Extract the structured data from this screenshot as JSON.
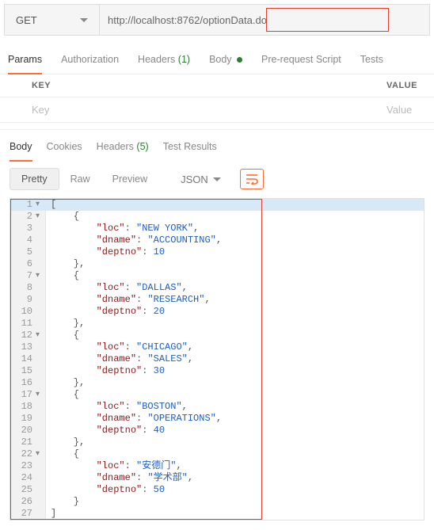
{
  "request": {
    "method": "GET",
    "url": "http://localhost:8762/optionData.do"
  },
  "requestTabs": {
    "params": "Params",
    "auth": "Authorization",
    "headers": "Headers",
    "headersCount": "(1)",
    "body": "Body",
    "prerequest": "Pre-request Script",
    "tests": "Tests"
  },
  "kv": {
    "keyHeader": "KEY",
    "valueHeader": "VALUE",
    "keyPlaceholder": "Key",
    "valuePlaceholder": "Value"
  },
  "responseTabs": {
    "body": "Body",
    "cookies": "Cookies",
    "headers": "Headers",
    "headersCount": "(5)",
    "testResults": "Test Results"
  },
  "viewer": {
    "pretty": "Pretty",
    "raw": "Raw",
    "preview": "Preview",
    "format": "JSON"
  },
  "chart_data": {
    "type": "table",
    "title": "optionData.do JSON response",
    "columns": [
      "loc",
      "dname",
      "deptno"
    ],
    "rows": [
      {
        "loc": "NEW YORK",
        "dname": "ACCOUNTING",
        "deptno": 10
      },
      {
        "loc": "DALLAS",
        "dname": "RESEARCH",
        "deptno": 20
      },
      {
        "loc": "CHICAGO",
        "dname": "SALES",
        "deptno": 30
      },
      {
        "loc": "BOSTON",
        "dname": "OPERATIONS",
        "deptno": 40
      },
      {
        "loc": "安德门",
        "dname": "学术部",
        "deptno": 50
      }
    ]
  },
  "codeLines": [
    {
      "n": 1,
      "fold": "▾",
      "tokens": [
        [
          "punc",
          "["
        ]
      ]
    },
    {
      "n": 2,
      "fold": "▾",
      "tokens": [
        [
          "punc",
          "    {"
        ]
      ]
    },
    {
      "n": 3,
      "fold": "",
      "tokens": [
        [
          "punc",
          "        "
        ],
        [
          "key",
          "\"loc\""
        ],
        [
          "punc",
          ": "
        ],
        [
          "str",
          "\"NEW YORK\""
        ],
        [
          "punc",
          ","
        ]
      ]
    },
    {
      "n": 4,
      "fold": "",
      "tokens": [
        [
          "punc",
          "        "
        ],
        [
          "key",
          "\"dname\""
        ],
        [
          "punc",
          ": "
        ],
        [
          "str",
          "\"ACCOUNTING\""
        ],
        [
          "punc",
          ","
        ]
      ]
    },
    {
      "n": 5,
      "fold": "",
      "tokens": [
        [
          "punc",
          "        "
        ],
        [
          "key",
          "\"deptno\""
        ],
        [
          "punc",
          ": "
        ],
        [
          "num",
          "10"
        ]
      ]
    },
    {
      "n": 6,
      "fold": "",
      "tokens": [
        [
          "punc",
          "    },"
        ]
      ]
    },
    {
      "n": 7,
      "fold": "▾",
      "tokens": [
        [
          "punc",
          "    {"
        ]
      ]
    },
    {
      "n": 8,
      "fold": "",
      "tokens": [
        [
          "punc",
          "        "
        ],
        [
          "key",
          "\"loc\""
        ],
        [
          "punc",
          ": "
        ],
        [
          "str",
          "\"DALLAS\""
        ],
        [
          "punc",
          ","
        ]
      ]
    },
    {
      "n": 9,
      "fold": "",
      "tokens": [
        [
          "punc",
          "        "
        ],
        [
          "key",
          "\"dname\""
        ],
        [
          "punc",
          ": "
        ],
        [
          "str",
          "\"RESEARCH\""
        ],
        [
          "punc",
          ","
        ]
      ]
    },
    {
      "n": 10,
      "fold": "",
      "tokens": [
        [
          "punc",
          "        "
        ],
        [
          "key",
          "\"deptno\""
        ],
        [
          "punc",
          ": "
        ],
        [
          "num",
          "20"
        ]
      ]
    },
    {
      "n": 11,
      "fold": "",
      "tokens": [
        [
          "punc",
          "    },"
        ]
      ]
    },
    {
      "n": 12,
      "fold": "▾",
      "tokens": [
        [
          "punc",
          "    {"
        ]
      ]
    },
    {
      "n": 13,
      "fold": "",
      "tokens": [
        [
          "punc",
          "        "
        ],
        [
          "key",
          "\"loc\""
        ],
        [
          "punc",
          ": "
        ],
        [
          "str",
          "\"CHICAGO\""
        ],
        [
          "punc",
          ","
        ]
      ]
    },
    {
      "n": 14,
      "fold": "",
      "tokens": [
        [
          "punc",
          "        "
        ],
        [
          "key",
          "\"dname\""
        ],
        [
          "punc",
          ": "
        ],
        [
          "str",
          "\"SALES\""
        ],
        [
          "punc",
          ","
        ]
      ]
    },
    {
      "n": 15,
      "fold": "",
      "tokens": [
        [
          "punc",
          "        "
        ],
        [
          "key",
          "\"deptno\""
        ],
        [
          "punc",
          ": "
        ],
        [
          "num",
          "30"
        ]
      ]
    },
    {
      "n": 16,
      "fold": "",
      "tokens": [
        [
          "punc",
          "    },"
        ]
      ]
    },
    {
      "n": 17,
      "fold": "▾",
      "tokens": [
        [
          "punc",
          "    {"
        ]
      ]
    },
    {
      "n": 18,
      "fold": "",
      "tokens": [
        [
          "punc",
          "        "
        ],
        [
          "key",
          "\"loc\""
        ],
        [
          "punc",
          ": "
        ],
        [
          "str",
          "\"BOSTON\""
        ],
        [
          "punc",
          ","
        ]
      ]
    },
    {
      "n": 19,
      "fold": "",
      "tokens": [
        [
          "punc",
          "        "
        ],
        [
          "key",
          "\"dname\""
        ],
        [
          "punc",
          ": "
        ],
        [
          "str",
          "\"OPERATIONS\""
        ],
        [
          "punc",
          ","
        ]
      ]
    },
    {
      "n": 20,
      "fold": "",
      "tokens": [
        [
          "punc",
          "        "
        ],
        [
          "key",
          "\"deptno\""
        ],
        [
          "punc",
          ": "
        ],
        [
          "num",
          "40"
        ]
      ]
    },
    {
      "n": 21,
      "fold": "",
      "tokens": [
        [
          "punc",
          "    },"
        ]
      ]
    },
    {
      "n": 22,
      "fold": "▾",
      "tokens": [
        [
          "punc",
          "    {"
        ]
      ]
    },
    {
      "n": 23,
      "fold": "",
      "tokens": [
        [
          "punc",
          "        "
        ],
        [
          "key",
          "\"loc\""
        ],
        [
          "punc",
          ": "
        ],
        [
          "str",
          "\"安德门\""
        ],
        [
          "punc",
          ","
        ]
      ]
    },
    {
      "n": 24,
      "fold": "",
      "tokens": [
        [
          "punc",
          "        "
        ],
        [
          "key",
          "\"dname\""
        ],
        [
          "punc",
          ": "
        ],
        [
          "str",
          "\"学术部\""
        ],
        [
          "punc",
          ","
        ]
      ]
    },
    {
      "n": 25,
      "fold": "",
      "tokens": [
        [
          "punc",
          "        "
        ],
        [
          "key",
          "\"deptno\""
        ],
        [
          "punc",
          ": "
        ],
        [
          "num",
          "50"
        ]
      ]
    },
    {
      "n": 26,
      "fold": "",
      "tokens": [
        [
          "punc",
          "    }"
        ]
      ]
    },
    {
      "n": 27,
      "fold": "",
      "tokens": [
        [
          "punc",
          "]"
        ]
      ]
    }
  ]
}
